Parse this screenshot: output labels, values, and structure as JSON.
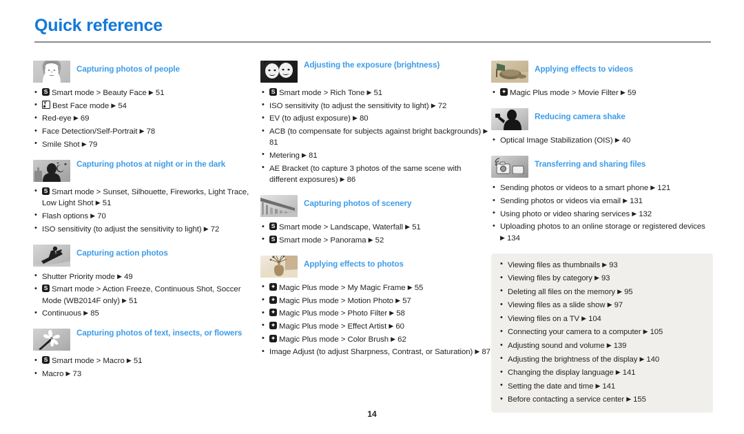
{
  "document": {
    "title": "Quick reference",
    "page_number": "14",
    "accent_title_color": "#1279d8",
    "accent_heading_color": "#3f9de8",
    "tipbox_background": "#f1efeb",
    "text_color": "#231f20"
  },
  "columns": [
    {
      "sections": [
        {
          "icon": "portrait-photo-thumbnail",
          "heading": "Capturing photos of people",
          "items": [
            {
              "badge": "smart-mode-icon",
              "text": "Smart mode > Beauty Face",
              "page": "51"
            },
            {
              "badge": "best-face-mode-icon",
              "text": "Best Face mode",
              "page": "54"
            },
            {
              "badge": "",
              "text": "Red-eye",
              "page": "69"
            },
            {
              "badge": "",
              "text": "Face Detection/Self-Portrait",
              "page": "78"
            },
            {
              "badge": "",
              "text": "Smile Shot",
              "page": "79"
            }
          ]
        },
        {
          "icon": "night-scene-thumbnail",
          "heading": "Capturing photos at night or in the dark",
          "items": [
            {
              "badge": "smart-mode-icon",
              "text": "Smart mode > Sunset, Silhouette, Fireworks, Light Trace, Low Light Shot",
              "page": "51"
            },
            {
              "badge": "",
              "text": "Flash options",
              "page": "70"
            },
            {
              "badge": "",
              "text": "ISO sensitivity (to adjust the sensitivity to light)",
              "page": "72"
            }
          ]
        },
        {
          "icon": "snowboarder-action-thumbnail",
          "heading": "Capturing action photos",
          "items": [
            {
              "badge": "",
              "text": "Shutter Priority mode",
              "page": "49"
            },
            {
              "badge": "smart-mode-icon",
              "text": "Smart mode > Action Freeze, Continuous Shot, Soccer Mode (WB2014F only)",
              "page": "51"
            },
            {
              "badge": "",
              "text": "Continuous",
              "page": "85"
            }
          ]
        },
        {
          "icon": "flower-macro-thumbnail",
          "heading": "Capturing photos of text, insects, or flowers",
          "items": [
            {
              "badge": "smart-mode-icon",
              "text": "Smart mode > Macro",
              "page": "51"
            },
            {
              "badge": "",
              "text": "Macro",
              "page": "73"
            }
          ]
        }
      ]
    },
    {
      "sections": [
        {
          "icon": "two-faces-exposure-thumbnail",
          "heading": "Adjusting the exposure (brightness)",
          "items": [
            {
              "badge": "smart-mode-icon",
              "text": "Smart mode > Rich Tone",
              "page": "51"
            },
            {
              "badge": "",
              "text": "ISO sensitivity (to adjust the sensitivity to light)",
              "page": "72"
            },
            {
              "badge": "",
              "text": "EV (to adjust exposure)",
              "page": "80"
            },
            {
              "badge": "",
              "text": "ACB (to compensate for subjects against bright backgrounds)",
              "page": "81"
            },
            {
              "badge": "",
              "text": "Metering",
              "page": "81"
            },
            {
              "badge": "",
              "text": "AE Bracket (to capture 3 photos of the same scene with different exposures)",
              "page": "86"
            }
          ]
        },
        {
          "icon": "bridge-scenery-thumbnail",
          "heading": "Capturing photos of scenery",
          "items": [
            {
              "badge": "smart-mode-icon",
              "text": "Smart mode > Landscape, Waterfall",
              "page": "51"
            },
            {
              "badge": "smart-mode-icon",
              "text": "Smart mode > Panorama",
              "page": "52"
            }
          ]
        },
        {
          "icon": "vase-effects-thumbnail",
          "heading": "Applying effects to photos",
          "items": [
            {
              "badge": "magic-plus-icon",
              "text": "Magic Plus mode > My Magic Frame",
              "page": "55"
            },
            {
              "badge": "magic-plus-icon",
              "text": "Magic Plus mode > Motion Photo",
              "page": "57"
            },
            {
              "badge": "magic-plus-icon",
              "text": "Magic Plus mode > Photo Filter",
              "page": "58"
            },
            {
              "badge": "magic-plus-icon",
              "text": "Magic Plus mode > Effect Artist",
              "page": "60"
            },
            {
              "badge": "magic-plus-icon",
              "text": "Magic Plus mode > Color Brush",
              "page": "62"
            },
            {
              "badge": "",
              "text": "Image Adjust (to adjust Sharpness, Contrast, or Saturation)",
              "page": "87"
            }
          ]
        }
      ]
    },
    {
      "sections": [
        {
          "icon": "video-effects-thumbnail",
          "heading": "Applying effects to videos",
          "items": [
            {
              "badge": "magic-plus-icon",
              "text": "Magic Plus mode > Movie Filter",
              "page": "59"
            }
          ]
        },
        {
          "icon": "camera-shake-thumbnail",
          "heading": "Reducing camera shake",
          "items": [
            {
              "badge": "",
              "text": "Optical Image Stabilization (OIS)",
              "page": "40"
            }
          ]
        },
        {
          "icon": "wifi-transfer-thumbnail",
          "heading": "Transferring and sharing files",
          "items": [
            {
              "badge": "",
              "text": "Sending photos or videos to a smart phone",
              "page": "121"
            },
            {
              "badge": "",
              "text": "Sending photos or videos via email",
              "page": "131"
            },
            {
              "badge": "",
              "text": "Using photo or video sharing services",
              "page": "132"
            },
            {
              "badge": "",
              "text": "Uploading photos to an online storage or registered devices",
              "page": "134"
            }
          ]
        }
      ],
      "tipbox": {
        "items": [
          {
            "text": "Viewing files as thumbnails",
            "page": "93"
          },
          {
            "text": "Viewing files by category",
            "page": "93"
          },
          {
            "text": "Deleting all files on the memory",
            "page": "95"
          },
          {
            "text": "Viewing files as a slide show",
            "page": "97"
          },
          {
            "text": "Viewing files on a TV",
            "page": "104"
          },
          {
            "text": "Connecting your camera to a computer",
            "page": "105"
          },
          {
            "text": "Adjusting sound and volume",
            "page": "139"
          },
          {
            "text": "Adjusting the brightness of the display",
            "page": "140"
          },
          {
            "text": "Changing the display language",
            "page": "141"
          },
          {
            "text": "Setting the date and time",
            "page": "141"
          },
          {
            "text": "Before contacting a service center",
            "page": "155"
          }
        ]
      }
    }
  ]
}
